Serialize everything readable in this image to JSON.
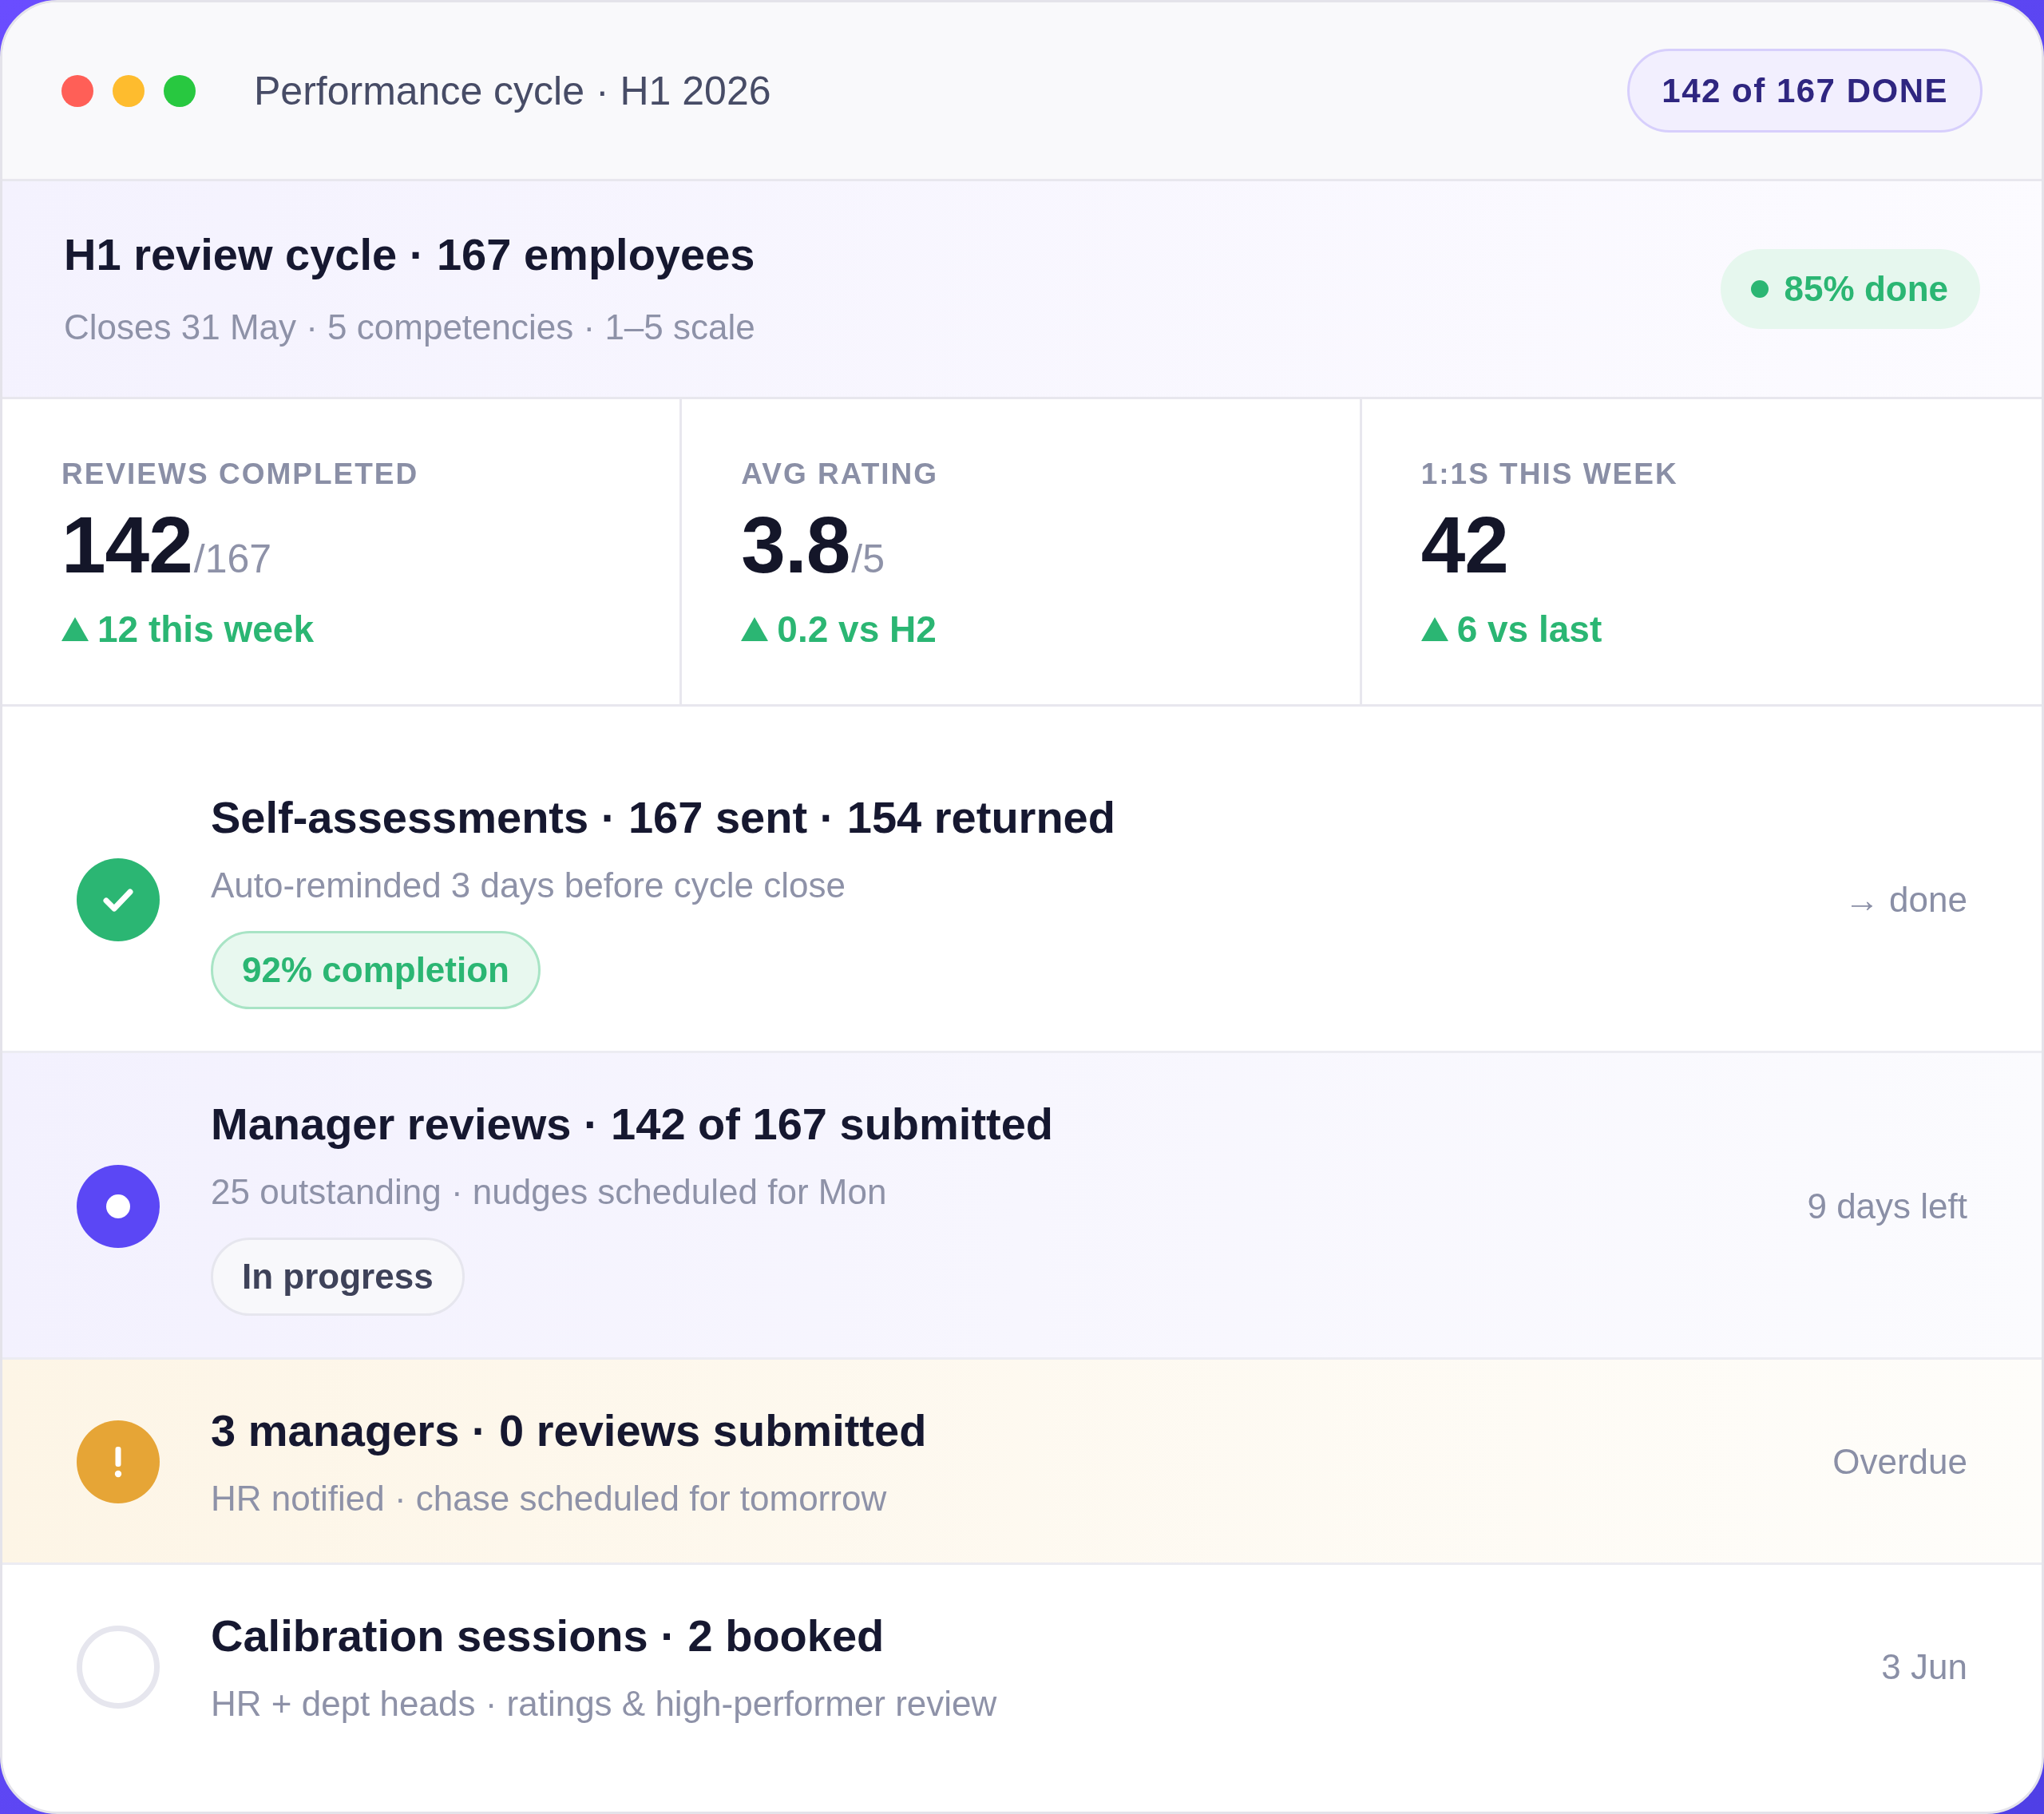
{
  "window": {
    "title": "Performance cycle · H1 2026",
    "badge": "142 of 167 DONE"
  },
  "cycle": {
    "title": "H1 review cycle · 167 employees",
    "subtitle": "Closes 31 May · 5 competencies · 1–5 scale",
    "status": "85% done"
  },
  "stats": [
    {
      "label": "REVIEWS COMPLETED",
      "value": "142",
      "unit": "/167",
      "delta": "12 this week"
    },
    {
      "label": "AVG RATING",
      "value": "3.8",
      "unit": "/5",
      "delta": "0.2 vs H2"
    },
    {
      "label": "1:1S THIS WEEK",
      "value": "42",
      "delta": "6 vs last"
    }
  ],
  "steps": [
    {
      "kind": "done",
      "title": "Self-assessments · 167 sent · 154 returned",
      "subtitle": "Auto-reminded 3 days before cycle close",
      "chip": "92% completion",
      "due": "→ done"
    },
    {
      "kind": "active",
      "title": "Manager reviews · 142 of 167 submitted",
      "subtitle": "25 outstanding · nudges scheduled for Mon",
      "chip": "In progress",
      "due": "9 days left"
    },
    {
      "kind": "overdue",
      "title": "3 managers · 0 reviews submitted",
      "subtitle": "HR notified · chase scheduled for tomorrow",
      "due": "Overdue"
    },
    {
      "kind": "upcoming",
      "title": "Calibration sessions · 2 booked",
      "subtitle": "HR + dept heads · ratings & high-performer review",
      "due": "3 Jun"
    }
  ]
}
